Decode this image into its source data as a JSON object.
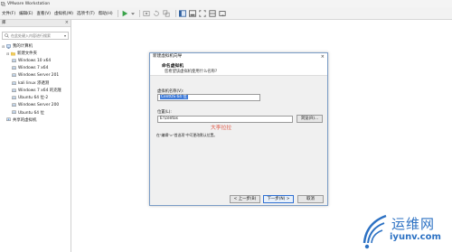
{
  "window": {
    "title": "VMware Workstation"
  },
  "menubar": {
    "items": [
      "文件(F)",
      "编辑(E)",
      "查看(V)",
      "虚拟机(M)",
      "选项卡(T)",
      "帮助(H)"
    ],
    "toolbar_icons": [
      "play-icon",
      "dropdown-icon",
      "snapshot-icon",
      "revert-snapshot-icon",
      "manage-snapshots-icon",
      "sidebar-toggle-icon",
      "thumbnail-icon",
      "fullscreen-icon",
      "unity-icon",
      "view-icon"
    ]
  },
  "sidebar": {
    "header": "库",
    "search_placeholder": "在此处键入内容进行搜索",
    "root": "我的计算机",
    "folder": "新建文件夹",
    "vms": [
      "Windows 10 x64",
      "Windows 7 x64",
      "Windows Server 201",
      "kali linux 渗透测",
      "Windows 7 x64 的克隆",
      "Ubuntu 64 位-2",
      "Windows Server 200",
      "Ubuntu 64 位"
    ],
    "shared": "共享的虚拟机"
  },
  "dialog": {
    "title": "新建虚拟机向导",
    "heading": "命名虚拟机",
    "subheading": "您希望该虚拟机使用什么名称?",
    "name_label": "虚拟机名称(V):",
    "name_value": "CentOS 64 位",
    "location_label": "位置(L):",
    "location_value": "E:\\centos",
    "browse_button": "浏览(R)...",
    "hint": "在\"编辑\">\"首选项\"中可更改默认位置。",
    "back_button": "< 上一步(B)",
    "next_button": "下一步(N) >",
    "cancel_button": "取消"
  },
  "overlay_text": "大李拉拉",
  "brand": {
    "name": "运维网",
    "url": "iyunv.com"
  },
  "colors": {
    "accent": "#3f7bd9",
    "dialog_border": "#7a9cc6",
    "brand": "#2c71c3",
    "overlay": "#e15b49"
  }
}
